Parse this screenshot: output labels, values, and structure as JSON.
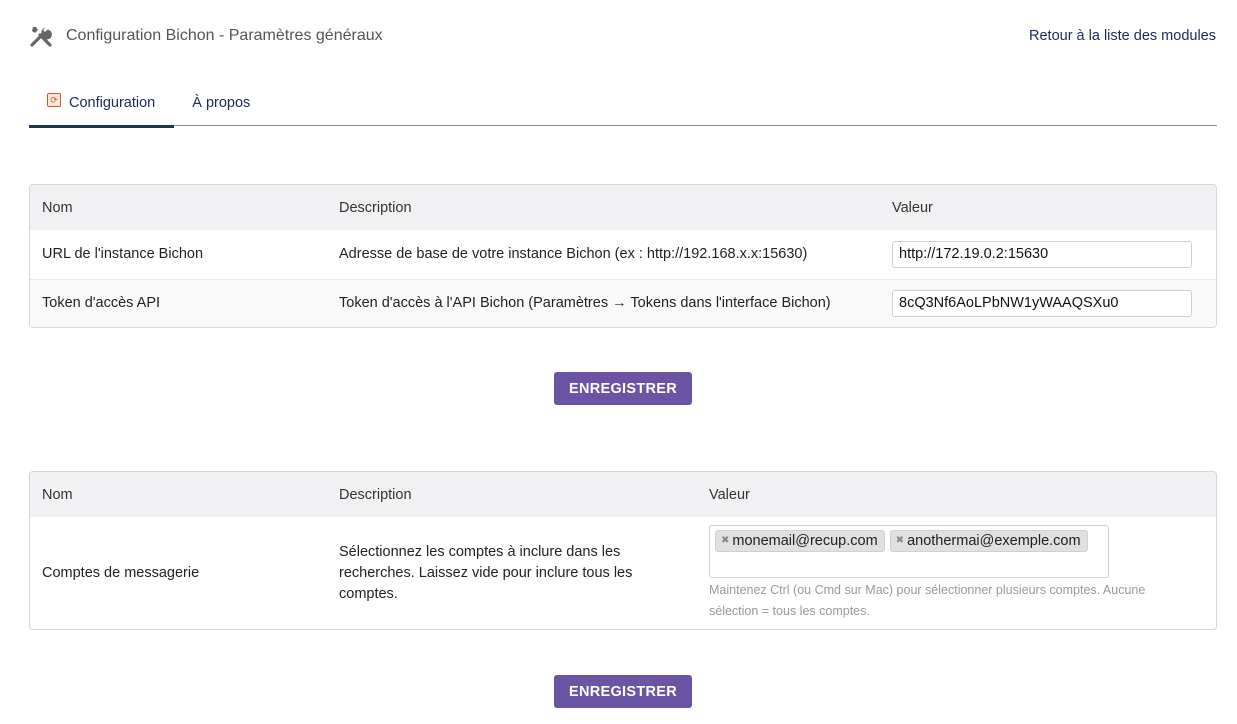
{
  "header": {
    "title": "Configuration Bichon - Paramètres généraux",
    "back_link": "Retour à la liste des modules"
  },
  "tabs": [
    {
      "label": "Configuration",
      "active": true
    },
    {
      "label": "À propos",
      "active": false
    }
  ],
  "general_table": {
    "columns": [
      "Nom",
      "Description",
      "Valeur"
    ],
    "rows": [
      {
        "name": "URL de l'instance Bichon",
        "description": "Adresse de base de votre instance Bichon (ex : http://192.168.x.x:15630)",
        "value": "http://172.19.0.2:15630"
      },
      {
        "name": "Token d'accès API",
        "description": "Token d'accès à l'API Bichon (Paramètres → Tokens dans l'interface Bichon)",
        "value": "8cQ3Nf6AoLPbNW1yWAAQSXu0"
      }
    ]
  },
  "save_button_1": "ENREGISTRER",
  "accounts_table": {
    "columns": [
      "Nom",
      "Description",
      "Valeur"
    ],
    "row": {
      "name": "Comptes de messagerie",
      "description": "Sélectionnez les comptes à inclure dans les recherches. Laissez vide pour inclure tous les comptes.",
      "selected": [
        "monemail@recup.com",
        "anothermai@exemple.com"
      ],
      "help": "Maintenez Ctrl (ou Cmd sur Mac) pour sélectionner plusieurs comptes. Aucune sélection = tous les comptes."
    }
  },
  "save_button_2": "ENREGISTRER",
  "colors": {
    "accent": "#6b54a3",
    "link": "#1a2a5a",
    "tab_underline": "#1d3452"
  },
  "icons": {
    "header": "tools-icon",
    "config_tab": "module-icon",
    "tag_remove": "remove-icon"
  }
}
